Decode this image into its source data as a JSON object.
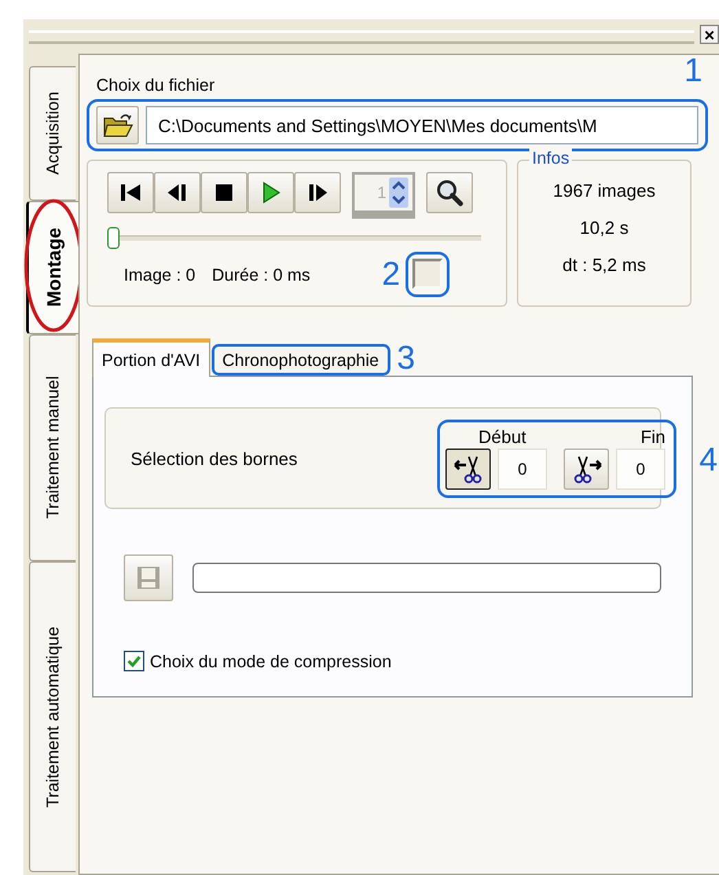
{
  "window": {
    "close": "×"
  },
  "side_tabs": [
    {
      "label": "Acquisition",
      "selected": false
    },
    {
      "label": "Montage",
      "selected": true
    },
    {
      "label": "Traitement manuel",
      "selected": false
    },
    {
      "label": "Traitement automatique",
      "selected": false
    }
  ],
  "file": {
    "label": "Choix du fichier",
    "path": "C:\\Documents and Settings\\MOYEN\\Mes documents\\M"
  },
  "player": {
    "transport": [
      {
        "kind": "first"
      },
      {
        "kind": "previous"
      },
      {
        "kind": "stop"
      },
      {
        "kind": "play"
      },
      {
        "kind": "next"
      }
    ],
    "spin_value": "1",
    "level": 0,
    "image_info": "Image : 0",
    "duration_info": "Durée : 0 ms",
    "toggle_on": false
  },
  "infos": {
    "title": "Infos",
    "lines": [
      "1967 images",
      "10,2 s",
      "dt : 5,2 ms"
    ]
  },
  "tabs": [
    {
      "label": "Portion d'AVI",
      "selected": true
    },
    {
      "label": "Chronophotographie",
      "selected": false
    }
  ],
  "bounds": {
    "label": "Sélection des bornes",
    "start": {
      "label": "Début",
      "value": "0",
      "pressed": true
    },
    "end": {
      "label": "Fin",
      "value": "0",
      "pressed": false
    }
  },
  "save": {
    "disabled": true
  },
  "progress": {
    "level": 0
  },
  "compression": {
    "label": "Choix du mode de compression",
    "checked": true
  },
  "callouts": [
    "1",
    "2",
    "3",
    "4"
  ]
}
